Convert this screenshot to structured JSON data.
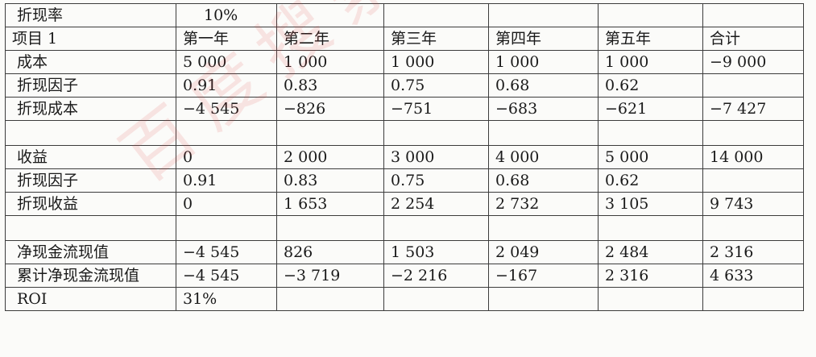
{
  "header_row": {
    "label": "折现率",
    "rate": "10%"
  },
  "columns": [
    "项目 1",
    "第一年",
    "第二年",
    "第三年",
    "第四年",
    "第五年",
    "合计"
  ],
  "rows": [
    [
      "成本",
      "5 000",
      "1 000",
      "1 000",
      "1 000",
      "1 000",
      "−9 000"
    ],
    [
      "折现因子",
      "0.91",
      "0.83",
      "0.75",
      "0.68",
      "0.62",
      ""
    ],
    [
      "折现成本",
      "−4 545",
      "−826",
      "−751",
      "−683",
      "−621",
      "−7 427"
    ],
    [
      "",
      "",
      "",
      "",
      "",
      "",
      ""
    ],
    [
      "收益",
      "0",
      "2 000",
      "3 000",
      "4 000",
      "5 000",
      "14 000"
    ],
    [
      "折现因子",
      "0.91",
      "0.83",
      "0.75",
      "0.68",
      "0.62",
      ""
    ],
    [
      "折现收益",
      "0",
      "1 653",
      "2 254",
      "2 732",
      "3 105",
      "9 743"
    ],
    [
      "",
      "",
      "",
      "",
      "",
      "",
      ""
    ],
    [
      "净现金流现值",
      "−4 545",
      "826",
      "1 503",
      "2 049",
      "2 484",
      "2 316"
    ],
    [
      "累计净现金流现值",
      "−4 545",
      "−3 719",
      "−2 216",
      "−167",
      "2 316",
      "4 633"
    ],
    [
      "ROI",
      "31%",
      "",
      "",
      "",
      "",
      ""
    ]
  ],
  "watermark_text": "百度搜索文库"
}
